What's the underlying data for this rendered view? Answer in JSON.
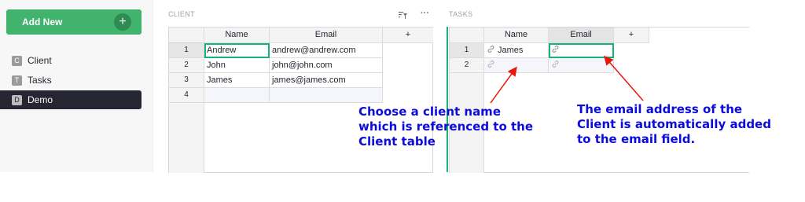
{
  "sidebar": {
    "add_new_label": "Add New",
    "add_new_icon": "+",
    "items": [
      {
        "badge": "C",
        "label": "Client",
        "active": false
      },
      {
        "badge": "T",
        "label": "Tasks",
        "active": false
      },
      {
        "badge": "D",
        "label": "Demo",
        "active": true
      }
    ]
  },
  "client": {
    "title": "CLIENT",
    "headers": [
      "Name",
      "Email",
      "+"
    ],
    "rows": [
      {
        "num": "1",
        "name": "Andrew",
        "email": "andrew@andrew.com"
      },
      {
        "num": "2",
        "name": "John",
        "email": "john@john.com"
      },
      {
        "num": "3",
        "name": "James",
        "email": "james@james.com"
      },
      {
        "num": "4",
        "name": "",
        "email": ""
      }
    ],
    "sort_filter_icon": "sort-filter-icon",
    "more_icon": "···"
  },
  "tasks": {
    "title": "TASKS",
    "headers": [
      "Name",
      "Email",
      "+"
    ],
    "rows": [
      {
        "num": "1",
        "name": "James",
        "email": ""
      },
      {
        "num": "2",
        "name": "",
        "email": ""
      }
    ]
  },
  "annotations": {
    "left": [
      "Choose a client name",
      "which is referenced to the",
      "Client table"
    ],
    "right": [
      "The email address of the",
      "Client is automatically added",
      "to the email field."
    ]
  },
  "colors": {
    "accent": "#16b378",
    "add_button": "#41b36d",
    "annotation_text": "#0b0bdc",
    "arrow": "#e8180c",
    "active_nav": "#262633"
  }
}
